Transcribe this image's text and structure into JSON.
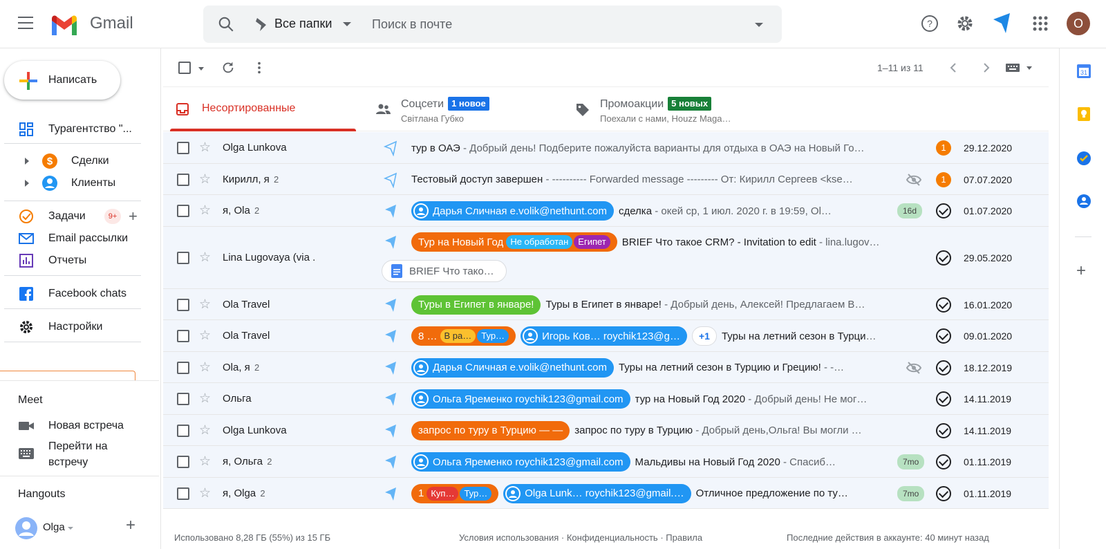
{
  "app": {
    "name": "Gmail"
  },
  "search": {
    "folder": "Все папки",
    "placeholder": "Поиск в почте"
  },
  "account": {
    "initial": "O"
  },
  "sidebar": {
    "compose": "Написать",
    "items": [
      {
        "label": "Турагентство \"..."
      },
      {
        "label": "Сделки"
      },
      {
        "label": "Клиенты"
      },
      {
        "label": "Задачи",
        "badge": "9+"
      },
      {
        "label": "Email рассылки"
      },
      {
        "label": "Отчеты"
      },
      {
        "label": "Facebook chats"
      },
      {
        "label": "Настройки"
      }
    ],
    "meet": {
      "title": "Meet",
      "new_meeting": "Новая встреча",
      "join_line1": "Перейти на",
      "join_line2": "встречу"
    },
    "hangouts": {
      "title": "Hangouts",
      "user": "Olga"
    }
  },
  "toolbar": {
    "range": "1–11 из 11"
  },
  "tabs": [
    {
      "title": "Несортированные"
    },
    {
      "title": "Соцсети",
      "badge": "1 новое",
      "badge_color": "#1a73e8",
      "sub": "Світлана Губко"
    },
    {
      "title": "Промоакции",
      "badge": "5 новых",
      "badge_color": "#188038",
      "sub": "Поехали с нами, Houzz Maga…"
    }
  ],
  "emails": [
    {
      "sender": "Olga Lunkova",
      "count": "",
      "subject": "тур в ОАЭ",
      "snippet": " - Добрый день! Подберите пожалуйста варианты для отдыха в ОАЭ на Новый Го…",
      "date": "29.12.2020",
      "status": "1"
    },
    {
      "sender": "Кирилл, я",
      "count": "2",
      "subject": "Тестовый доступ завершен",
      "snippet": " - ---------- Forwarded message --------- От: Кирилл Сергеев <kse…",
      "date": "07.07.2020",
      "status": "1"
    },
    {
      "sender": "я, Ola",
      "count": "2",
      "contact": "Дарья Сличная e.volik@nethunt.com",
      "subject": "сделка",
      "snippet": " - окей ср, 1 июл. 2020 г. в 19:59, Ol…",
      "age": "16d",
      "date": "01.07.2020"
    },
    {
      "sender": "Lina Lugovaya (via .",
      "count": "",
      "deal": "Тур на Новый Год",
      "deal_status": "Не обработан",
      "deal_tag": "Египет",
      "subject": "BRIEF Что такое CRM? - Invitation to edit",
      "snippet": " - lina.lugov…",
      "attachment": "BRIEF Что тако…",
      "date": "29.05.2020"
    },
    {
      "sender": "Ola Travel",
      "count": "",
      "deal": "Туры в Египет в январе!",
      "subject": "Туры в Египет в январе!",
      "snippet": " - Добрый день, Алексей! Предлагаем В…",
      "date": "16.01.2020"
    },
    {
      "sender": "Ola Travel",
      "count": "",
      "deal": "8 …",
      "deal_status": "В ра…",
      "deal_tag": "Тур…",
      "contact": "Игорь Ков…  roychik123@g…",
      "extra": "+1",
      "subject": "Туры на летний сезон в Турцию…",
      "snippet": "",
      "date": "09.01.2020"
    },
    {
      "sender": "Ola, я",
      "count": "2",
      "contact": "Дарья Сличная e.volik@nethunt.com",
      "subject": "Туры на летний сезон в Турцию и Грецию!",
      "snippet": " - -…",
      "date": "18.12.2019"
    },
    {
      "sender": "Ольга",
      "count": "",
      "contact": "Ольга Яременко roychik123@gmail.com",
      "subject": "тур на Новый Год 2020",
      "snippet": " - Добрый день! Не мог…",
      "date": "14.11.2019"
    },
    {
      "sender": "Olga Lunkova",
      "count": "",
      "deal": "запрос по туру в Турцию  —  —",
      "subject": "запрос по туру в Турцию",
      "snippet": " - Добрый день,Ольга! Вы могли …",
      "date": "14.11.2019"
    },
    {
      "sender": "я, Ольга",
      "count": "2",
      "contact": "Ольга Яременко roychik123@gmail.com",
      "subject": "Мальдивы на Новый Год 2020",
      "snippet": " - Спасиб…",
      "age": "7mo",
      "date": "01.11.2019"
    },
    {
      "sender": "я, Olga",
      "count": "2",
      "deal": "1",
      "deal_status": "Куп…",
      "deal_tag": "Тур…",
      "contact": "Olga Lunk…  roychik123@gmail.…",
      "subject": "Отличное предложение по ту…",
      "snippet": "",
      "age": "7mo",
      "date": "01.11.2019"
    }
  ],
  "footer": {
    "storage": "Использовано 8,28 ГБ (55%) из 15 ГБ",
    "links": "Условия использования · Конфиденциальность · Правила",
    "activity": "Последние действия в аккаунте: 40 минут назад"
  },
  "colors": {
    "accent_red": "#d93025",
    "contact_blue": "#2196f3",
    "deal_orange": "#f16b0b",
    "deal_green": "#5ec335",
    "badge_orange": "#f57c00"
  }
}
